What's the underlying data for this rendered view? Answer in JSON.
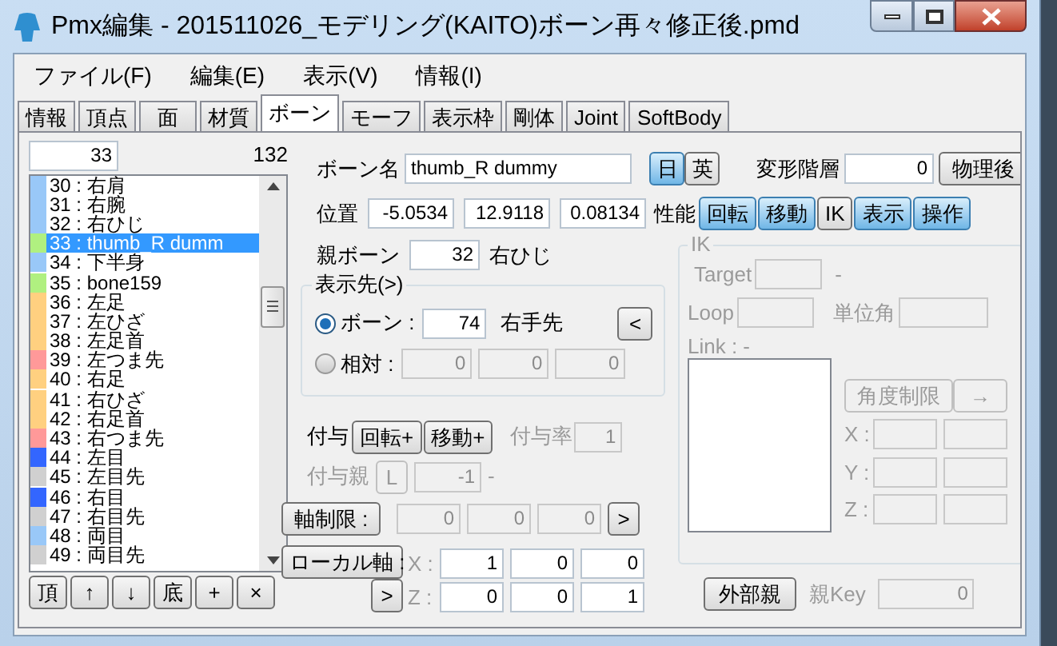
{
  "window": {
    "title": "Pmx編集 - 201511026_モデリング(KAITO)ボーン再々修正後.pmd"
  },
  "menu": [
    "ファイル(F)",
    "編集(E)",
    "表示(V)",
    "情報(I)"
  ],
  "tabs": [
    {
      "label": "情報",
      "selected": false
    },
    {
      "label": "頂点",
      "selected": false
    },
    {
      "label": "面",
      "selected": false
    },
    {
      "label": "材質",
      "selected": false
    },
    {
      "label": "ボーン",
      "selected": true
    },
    {
      "label": "モーフ",
      "selected": false
    },
    {
      "label": "表示枠",
      "selected": false
    },
    {
      "label": "剛体",
      "selected": false
    },
    {
      "label": "Joint",
      "selected": false
    },
    {
      "label": "SoftBody",
      "selected": false
    }
  ],
  "bone_list": {
    "index": "33",
    "count": "132",
    "items": [
      {
        "label": "30 : 右肩",
        "color": "#99c8f8",
        "selected": false
      },
      {
        "label": "31 : 右腕",
        "color": "#99c8f8",
        "selected": false
      },
      {
        "label": "32 : 右ひじ",
        "color": "#99c8f8",
        "selected": false
      },
      {
        "label": "33 : thumb_R dumm",
        "color": "#b0f080",
        "selected": true
      },
      {
        "label": "34 : 下半身",
        "color": "#99c8f8",
        "selected": false
      },
      {
        "label": "35 : bone159",
        "color": "#b0f080",
        "selected": false
      },
      {
        "label": "36 : 左足",
        "color": "#ffd080",
        "selected": false
      },
      {
        "label": "37 : 左ひざ",
        "color": "#ffd080",
        "selected": false
      },
      {
        "label": "38 : 左足首",
        "color": "#ffd080",
        "selected": false
      },
      {
        "label": "39 : 左つま先",
        "color": "#ff9999",
        "selected": false
      },
      {
        "label": "40 : 右足",
        "color": "#ffd080",
        "selected": false
      },
      {
        "label": "41 : 右ひざ",
        "color": "#ffd080",
        "selected": false
      },
      {
        "label": "42 : 右足首",
        "color": "#ffd080",
        "selected": false
      },
      {
        "label": "43 : 右つま先",
        "color": "#ff9999",
        "selected": false
      },
      {
        "label": "44 : 左目",
        "color": "#3366ff",
        "selected": false
      },
      {
        "label": "45 : 左目先",
        "color": "#d0d0d0",
        "selected": false
      },
      {
        "label": "46 : 右目",
        "color": "#3366ff",
        "selected": false
      },
      {
        "label": "47 : 右目先",
        "color": "#d0d0d0",
        "selected": false
      },
      {
        "label": "48 : 両目",
        "color": "#99c8f8",
        "selected": false
      },
      {
        "label": "49 : 両目先",
        "color": "#d0d0d0",
        "selected": false
      }
    ],
    "buttons": [
      "頂",
      "↑",
      "↓",
      "底",
      "+",
      "×"
    ]
  },
  "bone_name": {
    "label": "ボーン名",
    "value": "thumb_R dummy"
  },
  "language_buttons": [
    {
      "label": "日",
      "selected": true
    },
    {
      "label": "英",
      "selected": false
    }
  ],
  "deform_layer": {
    "label": "変形階層",
    "value": "0",
    "button": "物理後"
  },
  "position": {
    "label": "位置",
    "values": [
      "-5.0534",
      "12.9118",
      "0.08134"
    ]
  },
  "performance": {
    "label": "性能",
    "toggles": [
      {
        "label": "回転",
        "on": true
      },
      {
        "label": "移動",
        "on": true
      },
      {
        "label": "IK",
        "on": false
      },
      {
        "label": "表示",
        "on": true
      },
      {
        "label": "操作",
        "on": true
      }
    ]
  },
  "parent_bone": {
    "label": "親ボーン",
    "value": "32",
    "name": "右ひじ"
  },
  "display_target": {
    "title": "表示先(>)",
    "options": [
      {
        "kind": "bone",
        "label": "ボーン :",
        "selected": true,
        "value": "74",
        "name": "右手先",
        "button": "<"
      },
      {
        "kind": "relative",
        "label": "相対 :",
        "selected": false,
        "values": [
          "0",
          "0",
          "0"
        ]
      }
    ]
  },
  "grant": {
    "label": "付与",
    "toggles": [
      {
        "label": "回転+",
        "on": false
      },
      {
        "label": "移動+",
        "on": false
      }
    ],
    "rate_label": "付与率",
    "rate_value": "1",
    "parent_label": "付与親",
    "parent_button": "L",
    "parent_value": "-1",
    "parent_name": "-",
    "disabled": true
  },
  "axis_limit": {
    "button": "軸制限 :",
    "values": [
      "0",
      "0",
      "0"
    ],
    "arrow": ">"
  },
  "local_axis": {
    "button": "ローカル軸 :",
    "arrow": ">",
    "rows": [
      {
        "label": "X :",
        "values": [
          "1",
          "0",
          "0"
        ]
      },
      {
        "label": "Z :",
        "values": [
          "0",
          "0",
          "1"
        ]
      }
    ]
  },
  "ik": {
    "title": "IK",
    "disabled": true,
    "target_label": "Target",
    "target_name": "-",
    "loop_label": "Loop",
    "unit_angle_label": "単位角",
    "link_label": "Link : -",
    "angle_limit_button": "角度制限",
    "arrow": "→",
    "axes": [
      "X :",
      "Y :",
      "Z :"
    ]
  },
  "external_parent": {
    "button": "外部親",
    "key_label": "親Key",
    "key_value": "0"
  }
}
